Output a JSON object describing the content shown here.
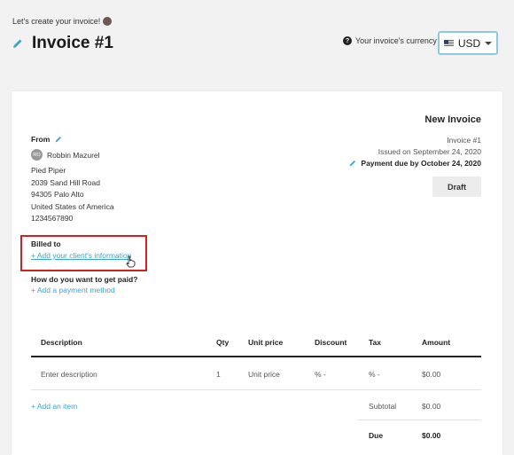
{
  "header": {
    "intro_text": "Let's create your invoice!",
    "title": "Invoice #1",
    "currency_hint": "Your invoice's currency",
    "currency_value": "USD"
  },
  "invoice": {
    "heading": "New Invoice",
    "number": "Invoice #1",
    "issued": "Issued on September 24, 2020",
    "payment_due": "Payment due by October 24, 2020",
    "status_button": "Draft"
  },
  "from": {
    "label": "From",
    "avatar_initials": "RO",
    "name": "Robbin Mazurel",
    "address_lines": [
      "Pied Piper",
      "2039 Sand Hill Road",
      "94305 Palo Alto",
      "United States of America",
      "1234567890"
    ]
  },
  "billed_to": {
    "label": "Billed to",
    "add_link": "+ Add your client's information"
  },
  "payment": {
    "question": "How do you want to get paid?",
    "add_link": "+ Add a payment method"
  },
  "table": {
    "headers": [
      "Description",
      "Qty",
      "Unit price",
      "Discount",
      "Tax",
      "Amount"
    ],
    "row": {
      "description_placeholder": "Enter description",
      "qty": "1",
      "unit_price_placeholder": "Unit price",
      "discount": "% -",
      "tax": "% -",
      "amount": "$0.00"
    },
    "add_item": "+ Add an item",
    "subtotal_label": "Subtotal",
    "subtotal_value": "$0.00",
    "due_label": "Due",
    "due_value": "$0.00"
  },
  "colors": {
    "accent_link": "#3aa6cf",
    "highlight_box": "#d42020",
    "currency_border": "#8ec9df"
  }
}
